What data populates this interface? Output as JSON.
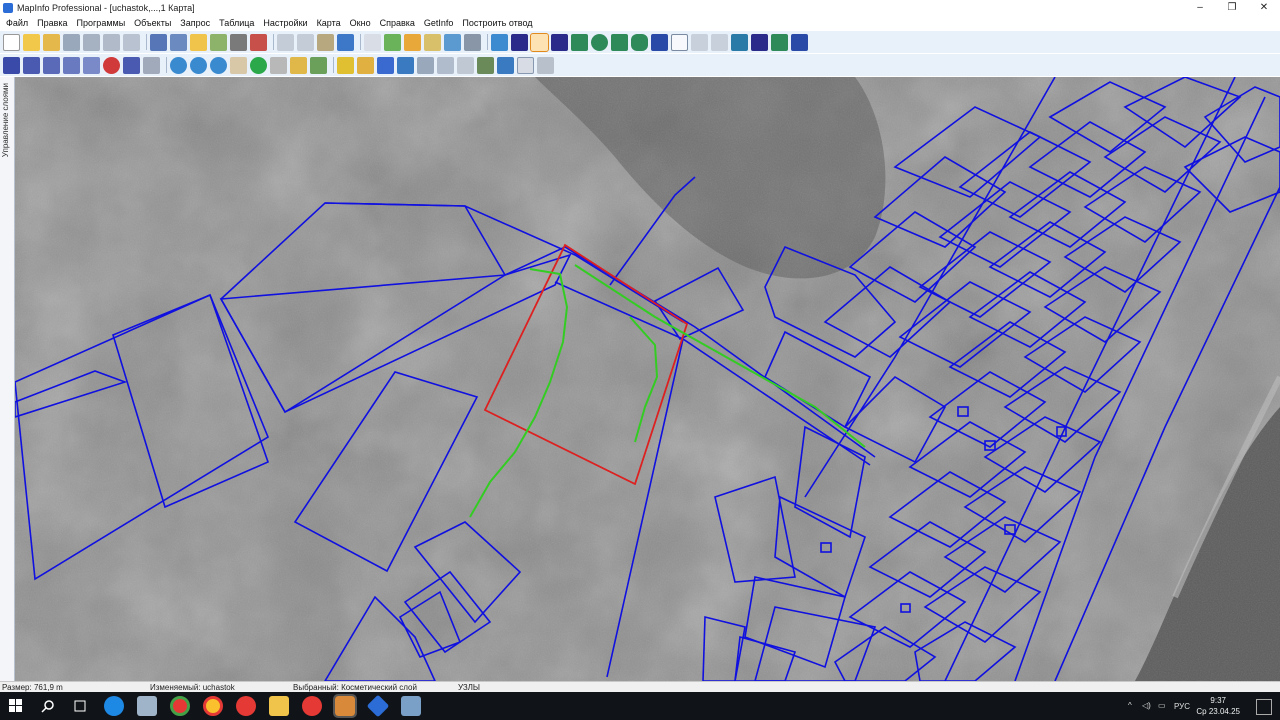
{
  "window": {
    "title": "MapInfo Professional - [uchastok,...,1 Карта]",
    "controls": [
      "–",
      "❐",
      "✕"
    ]
  },
  "menu": [
    "Файл",
    "Правка",
    "Программы",
    "Объекты",
    "Запрос",
    "Таблица",
    "Настройки",
    "Карта",
    "Окно",
    "Справка",
    "GetInfo",
    "Построить отвод"
  ],
  "side_panel": {
    "label": "Управление слоями"
  },
  "status": {
    "size": "Размер: 761,9 m",
    "editable": "Изменяемый: uchastok",
    "selected": "Выбранный: Косметический слой",
    "nodes": "УЗЛЫ"
  },
  "tray": {
    "lang": "РУС",
    "time": "9:37",
    "date": "Ср 23.04.25"
  },
  "colors": {
    "parcel": "#1010e0",
    "selection": "#dd2020",
    "path": "#33cc22",
    "toolbar_bg": "#e8f0fa",
    "taskbar_bg": "#101418"
  }
}
